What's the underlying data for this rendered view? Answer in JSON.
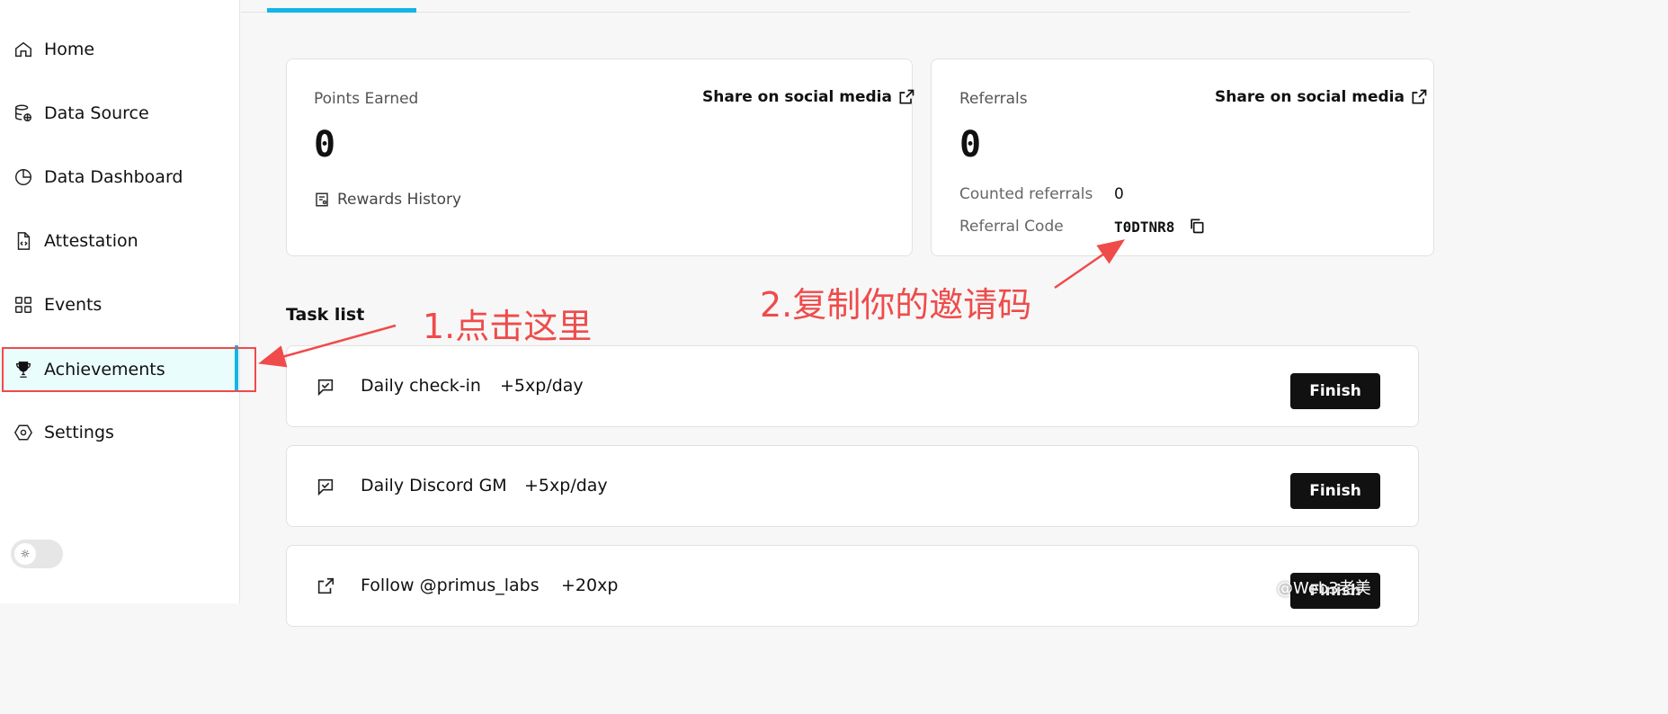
{
  "sidebar": {
    "items": [
      {
        "label": "Home",
        "icon": "home-icon"
      },
      {
        "label": "Data Source",
        "icon": "database-icon"
      },
      {
        "label": "Data Dashboard",
        "icon": "pie-chart-icon"
      },
      {
        "label": "Attestation",
        "icon": "file-code-icon"
      },
      {
        "label": "Events",
        "icon": "grid-icon"
      },
      {
        "label": "Achievements",
        "icon": "trophy-icon",
        "active": true
      },
      {
        "label": "Settings",
        "icon": "hexagon-settings-icon"
      }
    ],
    "theme_toggle_icon": "sun-icon"
  },
  "points_card": {
    "label": "Points Earned",
    "value": "0",
    "share_label": "Share on social media",
    "rewards_history_label": "Rewards History"
  },
  "referrals_card": {
    "label": "Referrals",
    "value": "0",
    "share_label": "Share on social media",
    "counted_label": "Counted referrals",
    "counted_value": "0",
    "code_label": "Referral Code",
    "code_value": "T0DTNR8"
  },
  "tasks": {
    "title": "Task list",
    "items": [
      {
        "name": "Daily check-in",
        "reward": "+5xp/day",
        "button": "Finish",
        "icon": "checkin-icon"
      },
      {
        "name": "Daily Discord GM",
        "reward": "+5xp/day",
        "button": "Finish",
        "icon": "checkin-icon"
      },
      {
        "name": "Follow @primus_labs",
        "reward": "+20xp",
        "button": "Finish",
        "icon": "external-link-icon"
      }
    ]
  },
  "annotations": {
    "step1": "1.点击这里",
    "step2": "2.复制你的邀请码"
  },
  "watermark": "@Web3老美",
  "colors": {
    "accent": "#12b5e8",
    "active_bg": "#e9fdfd",
    "annotation": "#ef4b4b",
    "button": "#111111"
  }
}
